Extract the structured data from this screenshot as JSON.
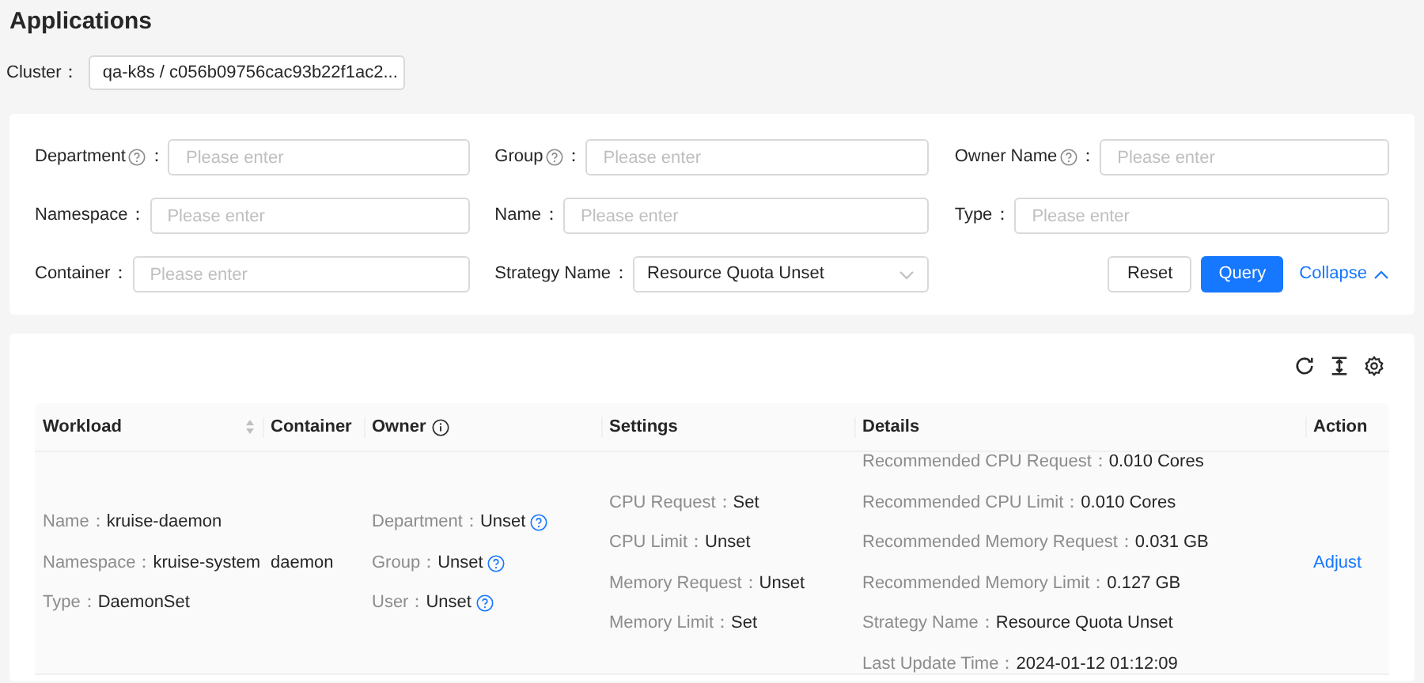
{
  "page_title": "Applications",
  "cluster": {
    "label": "Cluster",
    "colon": "：",
    "value": "qa-k8s / c056b09756cac93b22f1ac2..."
  },
  "filters": [
    {
      "label": "Department",
      "help": true,
      "colon": "：",
      "kind": "input",
      "placeholder": "Please enter"
    },
    {
      "label": "Group",
      "help": true,
      "colon": "：",
      "kind": "input",
      "placeholder": "Please enter"
    },
    {
      "label": "Owner Name",
      "help": true,
      "colon": "：",
      "kind": "input",
      "placeholder": "Please enter"
    },
    {
      "label": "Namespace",
      "help": false,
      "colon": "：",
      "kind": "input",
      "placeholder": "Please enter"
    },
    {
      "label": "Name",
      "help": false,
      "colon": "：",
      "kind": "input",
      "placeholder": "Please enter"
    },
    {
      "label": "Type",
      "help": false,
      "colon": "：",
      "kind": "input",
      "placeholder": "Please enter"
    },
    {
      "label": "Container",
      "help": false,
      "colon": "：",
      "kind": "input",
      "placeholder": "Please enter"
    },
    {
      "label": "Strategy Name",
      "help": false,
      "colon": "：",
      "kind": "select",
      "value": "Resource Quota Unset"
    }
  ],
  "filter_actions": {
    "reset": "Reset",
    "query": "Query",
    "collapse": "Collapse"
  },
  "table": {
    "columns": [
      {
        "label": "Workload",
        "sortable": true,
        "info": false
      },
      {
        "label": "Container",
        "sortable": false,
        "info": false
      },
      {
        "label": "Owner",
        "sortable": false,
        "info": true
      },
      {
        "label": "Settings",
        "sortable": false,
        "info": false
      },
      {
        "label": "Details",
        "sortable": false,
        "info": false
      },
      {
        "label": "Action",
        "sortable": false,
        "info": false
      }
    ],
    "rows": [
      {
        "workload": [
          {
            "key": "Name：",
            "value": "kruise-daemon"
          },
          {
            "key": "Namespace：",
            "value": "kruise-system"
          },
          {
            "key": "Type：",
            "value": "DaemonSet"
          }
        ],
        "container": "daemon",
        "owner": [
          {
            "key": "Department：",
            "value": "Unset",
            "help": true
          },
          {
            "key": "Group：",
            "value": "Unset",
            "help": true
          },
          {
            "key": "User：",
            "value": "Unset",
            "help": true
          }
        ],
        "settings": [
          {
            "key": "CPU Request：",
            "value": "Set"
          },
          {
            "key": "CPU Limit：",
            "value": "Unset"
          },
          {
            "key": "Memory Request：",
            "value": "Unset"
          },
          {
            "key": "Memory Limit：",
            "value": "Set"
          }
        ],
        "details": [
          {
            "key": "Recommended CPU Request：",
            "value": "0.010 Cores"
          },
          {
            "key": "Recommended CPU Limit：",
            "value": "0.010 Cores"
          },
          {
            "key": "Recommended Memory Request：",
            "value": "0.031 GB"
          },
          {
            "key": "Recommended Memory Limit：",
            "value": "0.127 GB"
          },
          {
            "key": "Strategy Name：",
            "value": "Resource Quota Unset"
          },
          {
            "key": "Last Update Time：",
            "value": "2024-01-12 01:12:09"
          }
        ],
        "action": "Adjust"
      }
    ]
  }
}
